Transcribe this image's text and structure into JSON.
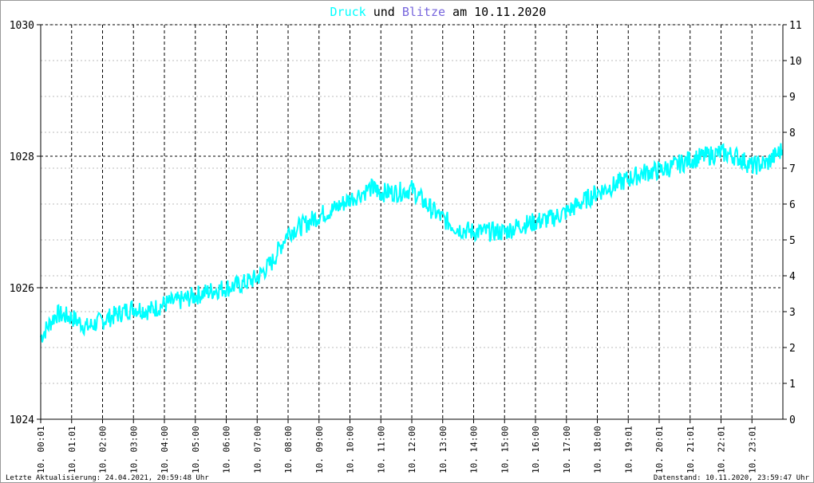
{
  "chart_data": {
    "type": "line",
    "title": {
      "part1": "Druck",
      "part2": " und ",
      "part3": "Blitze",
      "part4": " am 10.11.2020"
    },
    "colors": {
      "druck": "#00ffff",
      "blitze": "#7766dd",
      "text": "#000000",
      "grid": "#bbbbbb"
    },
    "y_left": {
      "min": 1024,
      "max": 1030,
      "ticks": [
        1024,
        1026,
        1028,
        1030
      ]
    },
    "y_right": {
      "min": 0,
      "max": 11,
      "ticks": [
        0,
        1,
        2,
        3,
        4,
        5,
        6,
        7,
        8,
        9,
        10,
        11
      ]
    },
    "x_range_hours": [
      0,
      24
    ],
    "x_ticks": [
      "10. 00:01",
      "10. 01:01",
      "10. 02:00",
      "10. 03:00",
      "10. 04:00",
      "10. 05:00",
      "10. 06:00",
      "10. 07:00",
      "10. 08:00",
      "10. 09:00",
      "10. 10:00",
      "10. 11:00",
      "10. 12:00",
      "10. 13:00",
      "10. 14:00",
      "10. 15:00",
      "10. 16:00",
      "10. 17:00",
      "10. 18:00",
      "10. 19:01",
      "10. 20:01",
      "10. 21:01",
      "10. 22:01",
      "10. 23:01"
    ],
    "series": [
      {
        "name": "Druck",
        "axis": "left",
        "x": [
          0,
          0.5,
          1,
          1.5,
          2,
          2.5,
          3,
          3.5,
          4,
          4.5,
          5,
          5.5,
          6,
          6.5,
          7,
          7.5,
          8,
          8.5,
          9,
          9.5,
          10,
          10.7,
          11,
          11.5,
          12,
          12.5,
          13,
          13.5,
          14,
          14.5,
          15,
          15.5,
          16,
          16.5,
          17,
          17.5,
          18,
          18.5,
          19,
          19.5,
          20,
          20.5,
          21,
          21.5,
          22,
          22.5,
          23,
          23.5,
          23.98
        ],
        "y": [
          1025.25,
          1025.6,
          1025.55,
          1025.4,
          1025.5,
          1025.6,
          1025.7,
          1025.65,
          1025.75,
          1025.8,
          1025.88,
          1025.95,
          1026.0,
          1026.05,
          1026.15,
          1026.4,
          1026.85,
          1026.95,
          1027.1,
          1027.2,
          1027.35,
          1027.52,
          1027.45,
          1027.45,
          1027.5,
          1027.25,
          1027.05,
          1026.9,
          1026.85,
          1026.85,
          1026.85,
          1026.95,
          1027.0,
          1027.05,
          1027.15,
          1027.3,
          1027.45,
          1027.55,
          1027.65,
          1027.75,
          1027.78,
          1027.85,
          1027.95,
          1028.0,
          1028.05,
          1028.0,
          1027.85,
          1027.9,
          1028.1
        ]
      },
      {
        "name": "Blitze",
        "axis": "right",
        "x": [],
        "y": []
      }
    ]
  },
  "footer": {
    "left": "Letzte Aktualisierung: 24.04.2021, 20:59:48 Uhr",
    "right": "Datenstand: 10.11.2020, 23:59:47 Uhr"
  }
}
